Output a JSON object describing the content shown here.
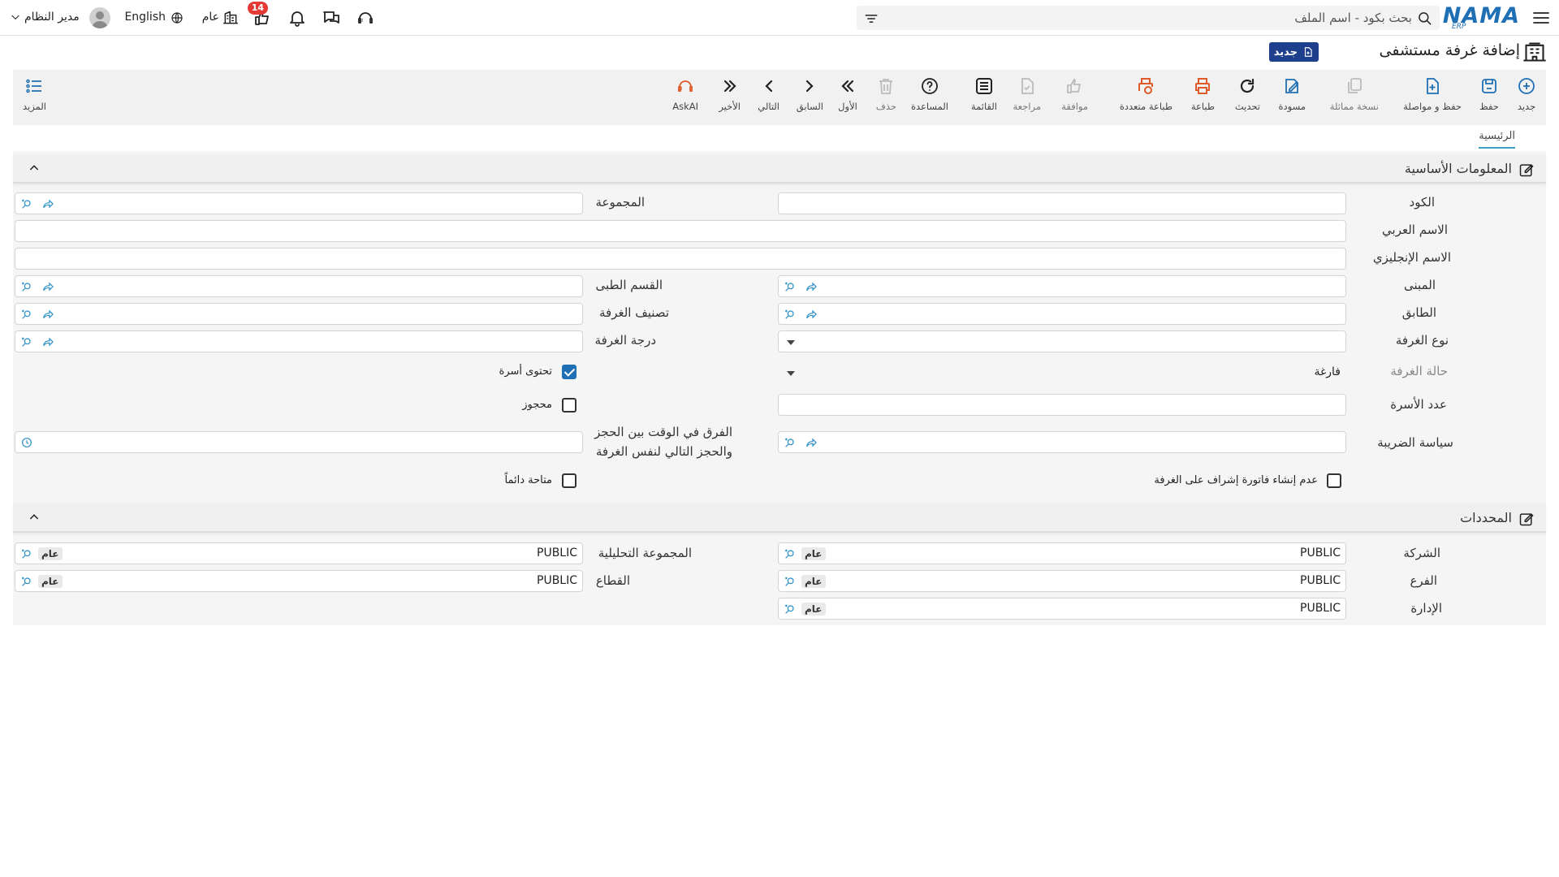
{
  "app": {
    "logo_text": "NAMA",
    "logo_sub": "ERP",
    "search_placeholder": "بحث بكود - اسم الملف",
    "user_name": "مدير النظام",
    "language": "English",
    "entity": "عام",
    "notification_count": "14"
  },
  "page": {
    "title": "إضافة غرفة مستشفى",
    "status_tag": "جديد",
    "main_tab": "الرئيسية"
  },
  "toolbar": {
    "new": "جديد",
    "save": "حفظ",
    "save_continue": "حفظ و مواصلة",
    "duplicate": "نسخة مماثلة",
    "draft": "مسودة",
    "refresh": "تحديث",
    "print": "طباعة",
    "multi_print": "طباعة متعددة",
    "approve": "موافقة",
    "review": "مراجعة",
    "list": "القائمة",
    "help": "المساعدة",
    "delete": "حذف",
    "first": "الأول",
    "previous": "السابق",
    "next": "التالي",
    "last": "الأخير",
    "askai": "AskAI",
    "more": "المزيد"
  },
  "basic": {
    "section_title": "المعلومات الأساسية",
    "code": "الكود",
    "group": "المجموعة",
    "arabic_name": "الاسم العربي",
    "english_name": "الاسم الإنجليزي",
    "building": "المبنى",
    "medical_dept": "القسم الطبى",
    "floor": "الطابق",
    "room_class": "تصنيف الغرفة",
    "room_type": "نوع الغرفة",
    "room_grade": "درجة الغرفة",
    "room_status": "حالة الغرفة",
    "room_status_value": "فارغة",
    "contains_beds": "تحتوى أسرة",
    "beds_count": "عدد الأسرة",
    "reserved": "محجوز",
    "tax_policy": "سياسة الضريبة",
    "time_diff_line1": "الفرق في الوقت بين الحجز",
    "time_diff_line2": "والحجز التالي لنفس الغرفة",
    "no_invoice": "عدم إنشاء فاتورة إشراف على الغرفة",
    "always_available": "متاحة دائماً"
  },
  "dims": {
    "section_title": "المحددات",
    "company": "الشركة",
    "analytic_group": "المجموعة التحليلية",
    "branch": "الفرع",
    "sector": "القطاع",
    "department": "الإدارة",
    "public_value": "PUBLIC",
    "general_tag": "عام"
  }
}
